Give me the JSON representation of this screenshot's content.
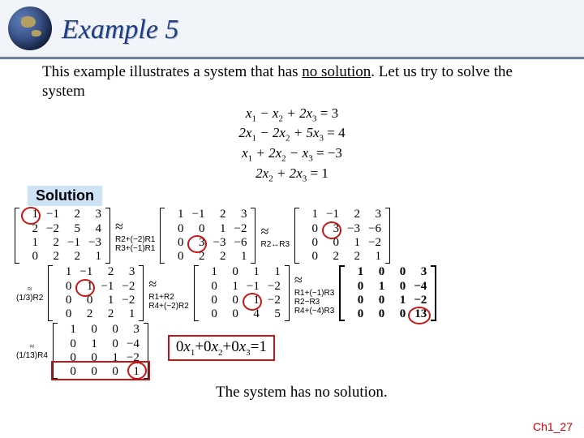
{
  "title": "Example 5",
  "intro_a": "This example illustrates a system that has ",
  "intro_no_solution": "no solution",
  "intro_b": ". Let us try to solve the system",
  "equations": {
    "line1": "x₁ − x₂ + 2x₃ = 3",
    "line2": "2x₁ − 2x₂ + 5x₃ = 4",
    "line3": "x₁ + 2x₂ − x₃ = −3",
    "line4": "2x₂ + 2x₃ = 1"
  },
  "solution_label": "Solution",
  "row_ops": {
    "op1a": "R2+(−2)R1",
    "op1b": "R3+(−1)R1",
    "op2": "R2↔R3",
    "op3": "(1/3)R2",
    "op4a": "R1+R2",
    "op4b": "R4+(−2)R2",
    "op5a": "R1+(−1)R3",
    "op5b": "R2−R3",
    "op5c": "R4+(−4)R3",
    "op6": "(1/13)R4"
  },
  "matrices": {
    "M0": [
      [
        "1",
        "−1",
        "2",
        "3"
      ],
      [
        "2",
        "−2",
        "5",
        "4"
      ],
      [
        "1",
        "2",
        "−1",
        "−3"
      ],
      [
        "0",
        "2",
        "2",
        "1"
      ]
    ],
    "M1": [
      [
        "1",
        "−1",
        "2",
        "3"
      ],
      [
        "0",
        "0",
        "1",
        "−2"
      ],
      [
        "0",
        "3",
        "−3",
        "−6"
      ],
      [
        "0",
        "2",
        "2",
        "1"
      ]
    ],
    "M2": [
      [
        "1",
        "−1",
        "2",
        "3"
      ],
      [
        "0",
        "3",
        "−3",
        "−6"
      ],
      [
        "0",
        "0",
        "1",
        "−2"
      ],
      [
        "0",
        "2",
        "2",
        "1"
      ]
    ],
    "M3": [
      [
        "1",
        "−1",
        "2",
        "3"
      ],
      [
        "0",
        "1",
        "−1",
        "−2"
      ],
      [
        "0",
        "0",
        "1",
        "−2"
      ],
      [
        "0",
        "2",
        "2",
        "1"
      ]
    ],
    "M4": [
      [
        "1",
        "0",
        "1",
        "1"
      ],
      [
        "0",
        "1",
        "−1",
        "−2"
      ],
      [
        "0",
        "0",
        "1",
        "−2"
      ],
      [
        "0",
        "0",
        "4",
        "5"
      ]
    ],
    "M5": [
      [
        "1",
        "0",
        "0",
        "3"
      ],
      [
        "0",
        "1",
        "0",
        "−4"
      ],
      [
        "0",
        "0",
        "1",
        "−2"
      ],
      [
        "0",
        "0",
        "0",
        "13"
      ]
    ],
    "M6": [
      [
        "1",
        "0",
        "0",
        "3"
      ],
      [
        "0",
        "1",
        "0",
        "−4"
      ],
      [
        "0",
        "0",
        "1",
        "−2"
      ],
      [
        "0",
        "0",
        "0",
        "1"
      ]
    ]
  },
  "boxed_equation": "0x₁+0x₂+0x₃=1",
  "conclusion": "The system has no solution.",
  "page_number": "Ch1_27"
}
